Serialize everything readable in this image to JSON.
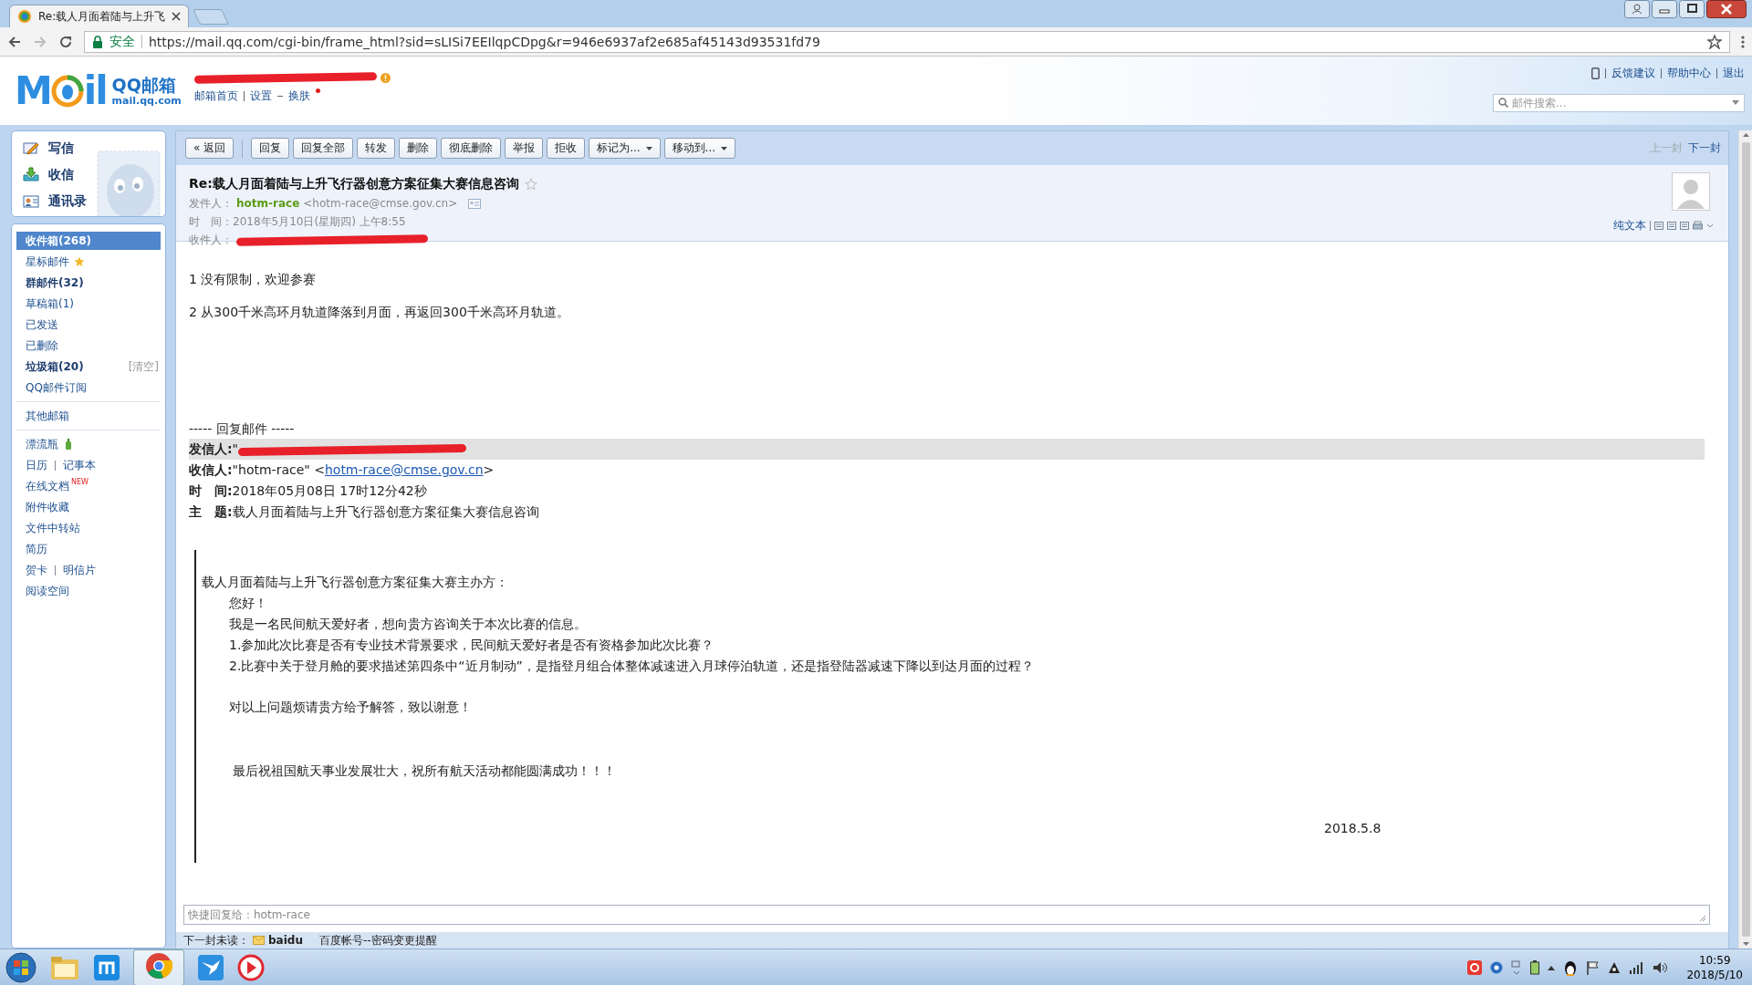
{
  "browser": {
    "tab_title": "Re:载人月面着陆与上升飞",
    "secure_label": "安全",
    "url": "https://mail.qq.com/cgi-bin/frame_html?sid=sLISi7EEIlqpCDpg&r=946e6937af2e685af45143d93531fd79"
  },
  "header": {
    "logo_letters": [
      "M",
      "il"
    ],
    "brand": "QQ邮箱",
    "domain": "mail.qq.com",
    "user_redacted": true,
    "links": [
      "邮箱首页",
      "设置",
      "换肤"
    ],
    "top_links": [
      "反馈建议",
      "帮助中心",
      "退出"
    ],
    "search_placeholder": "邮件搜索..."
  },
  "sidebar": {
    "actions": [
      {
        "kind": "compose",
        "label": "写信"
      },
      {
        "kind": "receive",
        "label": "收信"
      },
      {
        "kind": "contacts",
        "label": "通讯录"
      }
    ],
    "folders": [
      {
        "kind": "plain",
        "label": "收件箱(268)",
        "unread": true,
        "selected": true
      },
      {
        "kind": "starred",
        "label": "星标邮件",
        "unread": false,
        "selected": false
      },
      {
        "kind": "plain",
        "label": "群邮件(32)",
        "unread": true,
        "selected": false
      },
      {
        "kind": "plain",
        "label": "草稿箱(1)",
        "unread": false,
        "selected": false
      },
      {
        "kind": "plain",
        "label": "已发送",
        "unread": false,
        "selected": false
      },
      {
        "kind": "plain",
        "label": "已删除",
        "unread": false,
        "selected": false
      },
      {
        "kind": "trash",
        "label": "垃圾箱(20)",
        "action": "[清空]",
        "unread": true,
        "selected": false
      },
      {
        "kind": "plain",
        "label": "QQ邮件订阅",
        "unread": false,
        "selected": false
      }
    ],
    "other_mailboxes": "其他邮箱",
    "tools": [
      {
        "kind": "bottle",
        "labels": [
          "漂流瓶"
        ]
      },
      {
        "kind": "pair",
        "labels": [
          "日历",
          "记事本"
        ]
      },
      {
        "kind": "new",
        "labels": [
          "在线文档"
        ],
        "badge": "NEW"
      },
      {
        "kind": "plain",
        "labels": [
          "附件收藏"
        ]
      },
      {
        "kind": "plain",
        "labels": [
          "文件中转站"
        ]
      },
      {
        "kind": "plain",
        "labels": [
          "简历"
        ]
      },
      {
        "kind": "pair",
        "labels": [
          "贺卡",
          "明信片"
        ]
      },
      {
        "kind": "plain",
        "labels": [
          "阅读空间"
        ]
      }
    ]
  },
  "toolbar": {
    "back": "« 返回",
    "buttons": [
      {
        "kind": "plain",
        "label": "回复"
      },
      {
        "kind": "plain",
        "label": "回复全部"
      },
      {
        "kind": "plain",
        "label": "转发"
      },
      {
        "kind": "plain",
        "label": "删除"
      },
      {
        "kind": "plain",
        "label": "彻底删除"
      },
      {
        "kind": "plain",
        "label": "举报"
      },
      {
        "kind": "plain",
        "label": "拒收"
      },
      {
        "kind": "dropdown",
        "label": "标记为..."
      },
      {
        "kind": "dropdown",
        "label": "移动到..."
      }
    ],
    "nav": [
      {
        "label": "上一封",
        "disabled": true
      },
      {
        "label": "下一封",
        "disabled": false
      }
    ]
  },
  "message": {
    "subject": "Re:载人月面着陆与上升飞行器创意方案征集大赛信息咨询",
    "starred": false,
    "sender_label": "发件人：",
    "sender_name": "hotm-race",
    "sender_address": "<hotm-race@cmse.gov.cn>",
    "time_label": "时　间：",
    "time": "2018年5月10日(星期四) 上午8:55",
    "recipient_label": "收件人：",
    "recipient_redacted": true,
    "plain_text_link": "纯文本",
    "reply_lines": [
      "1 没有限制，欢迎参赛",
      "2 从300千米高环月轨道降落到月面，再返回300千米高环月轨道。"
    ],
    "quote_divider": "----- 回复邮件 -----",
    "quoted_headers": [
      {
        "label": "发信人:",
        "value": "\"",
        "redacted": true,
        "highlighted": true
      },
      {
        "label": "收信人:",
        "value": "\"hotm-race\" <",
        "link": "hotm-race@cmse.gov.cn",
        "suffix": ">",
        "redacted": false,
        "highlighted": false
      },
      {
        "label": "时　间:",
        "value": "2018年05月08日 17时12分42秒",
        "redacted": false,
        "highlighted": false
      },
      {
        "label": "主　题:",
        "value": "载人月面着陆与上升飞行器创意方案征集大赛信息咨询",
        "redacted": false,
        "highlighted": false
      }
    ],
    "quoted_body": [
      {
        "kind": "salutation",
        "text": "载人月面着陆与上升飞行器创意方案征集大赛主办方："
      },
      {
        "kind": "line",
        "text": "您好！"
      },
      {
        "kind": "line",
        "text": "我是一名民间航天爱好者，想向贵方咨询关于本次比赛的信息。"
      },
      {
        "kind": "line",
        "text": "1.参加此次比赛是否有专业技术背景要求，民间航天爱好者是否有资格参加此次比赛？"
      },
      {
        "kind": "line",
        "text": "2.比赛中关于登月舱的要求描述第四条中“近月制动”，是指登月组合体整体减速进入月球停泊轨道，还是指登陆器减速下降以到达月面的过程？"
      },
      {
        "kind": "paragraph",
        "text": "对以上问题烦请贵方给予解答，致以谢意！"
      },
      {
        "kind": "closing",
        "text": "最后祝祖国航天事业发展壮大，祝所有航天活动都能圆满成功！！！"
      },
      {
        "kind": "date",
        "text": "2018.5.8"
      }
    ],
    "quick_reply_placeholder": "快捷回复给：hotm-race",
    "next_unread_label": "下一封未读：",
    "next_unread_sender": "baidu",
    "next_unread_subject": "百度帐号--密码变更提醒"
  },
  "taskbar": {
    "time": "10:59",
    "date": "2018/5/10"
  }
}
